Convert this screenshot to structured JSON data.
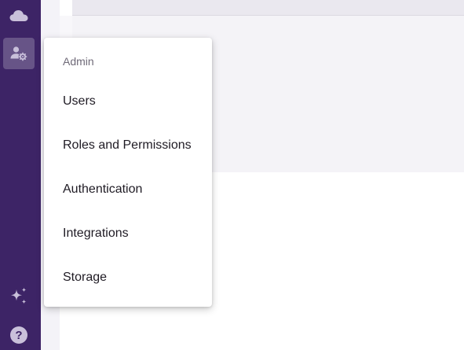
{
  "rail": {
    "items": [
      {
        "icon": "cloud-icon"
      },
      {
        "icon": "user-settings-icon",
        "active": true
      },
      {
        "icon": "sparkles-icon"
      },
      {
        "icon": "help-icon",
        "glyph": "?"
      }
    ]
  },
  "menu": {
    "header": "Admin",
    "items": [
      {
        "label": "Users"
      },
      {
        "label": "Roles and Permissions"
      },
      {
        "label": "Authentication"
      },
      {
        "label": "Integrations"
      },
      {
        "label": "Storage"
      }
    ]
  },
  "colors": {
    "rail": "#3d2466",
    "rail_active": "#6a5488",
    "icon": "#c9c0da"
  }
}
